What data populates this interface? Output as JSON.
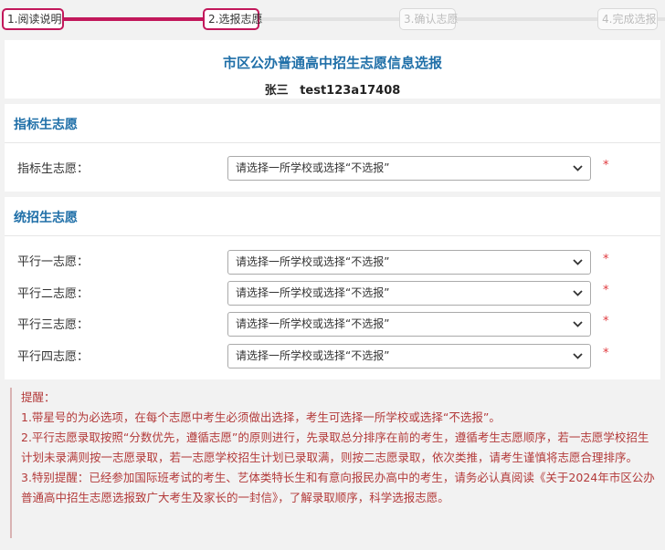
{
  "steps": [
    {
      "label": "1.阅读说明",
      "state": "done"
    },
    {
      "label": "2.选报志愿",
      "state": "current"
    },
    {
      "label": "3.确认志愿",
      "state": "pending"
    },
    {
      "label": "4.完成选报",
      "state": "pending"
    }
  ],
  "header": {
    "title": "市区公办普通高中招生志愿信息选报",
    "student_name": "张三",
    "student_id": "test123a17408"
  },
  "index_section": {
    "title": "指标生志愿",
    "rows": [
      {
        "label": "指标生志愿：",
        "value": "请选择一所学校或选择“不选报”",
        "required": "*"
      }
    ]
  },
  "unified_section": {
    "title": "统招生志愿",
    "rows": [
      {
        "label": "平行一志愿：",
        "value": "请选择一所学校或选择“不选报”",
        "required": "*"
      },
      {
        "label": "平行二志愿：",
        "value": "请选择一所学校或选择“不选报”",
        "required": "*"
      },
      {
        "label": "平行三志愿：",
        "value": "请选择一所学校或选择“不选报”",
        "required": "*"
      },
      {
        "label": "平行四志愿：",
        "value": "请选择一所学校或选择“不选报”",
        "required": "*"
      }
    ]
  },
  "notice": {
    "heading": "提醒：",
    "items": [
      "1.带星号的为必选项，在每个志愿中考生必须做出选择，考生可选择一所学校或选择“不选报”。",
      "2.平行志愿录取按照“分数优先，遵循志愿”的原则进行，先录取总分排序在前的考生，遵循考生志愿顺序，若一志愿学校招生计划未录满则按一志愿录取，若一志愿学校招生计划已录取满，则按二志愿录取，依次类推，请考生谨慎将志愿合理排序。",
      "3.特别提醒：已经参加国际班考试的考生、艺体类特长生和有意向报民办高中的考生，请务必认真阅读《关于2024年市区公办普通高中招生志愿选报致广大考生及家长的一封信》，了解录取顺序，科学选报志愿。"
    ]
  },
  "colors": {
    "accent": "#c2185b",
    "title_blue": "#1f6fa8",
    "notice_red": "#b33a3a",
    "required_red": "#e0393e"
  }
}
